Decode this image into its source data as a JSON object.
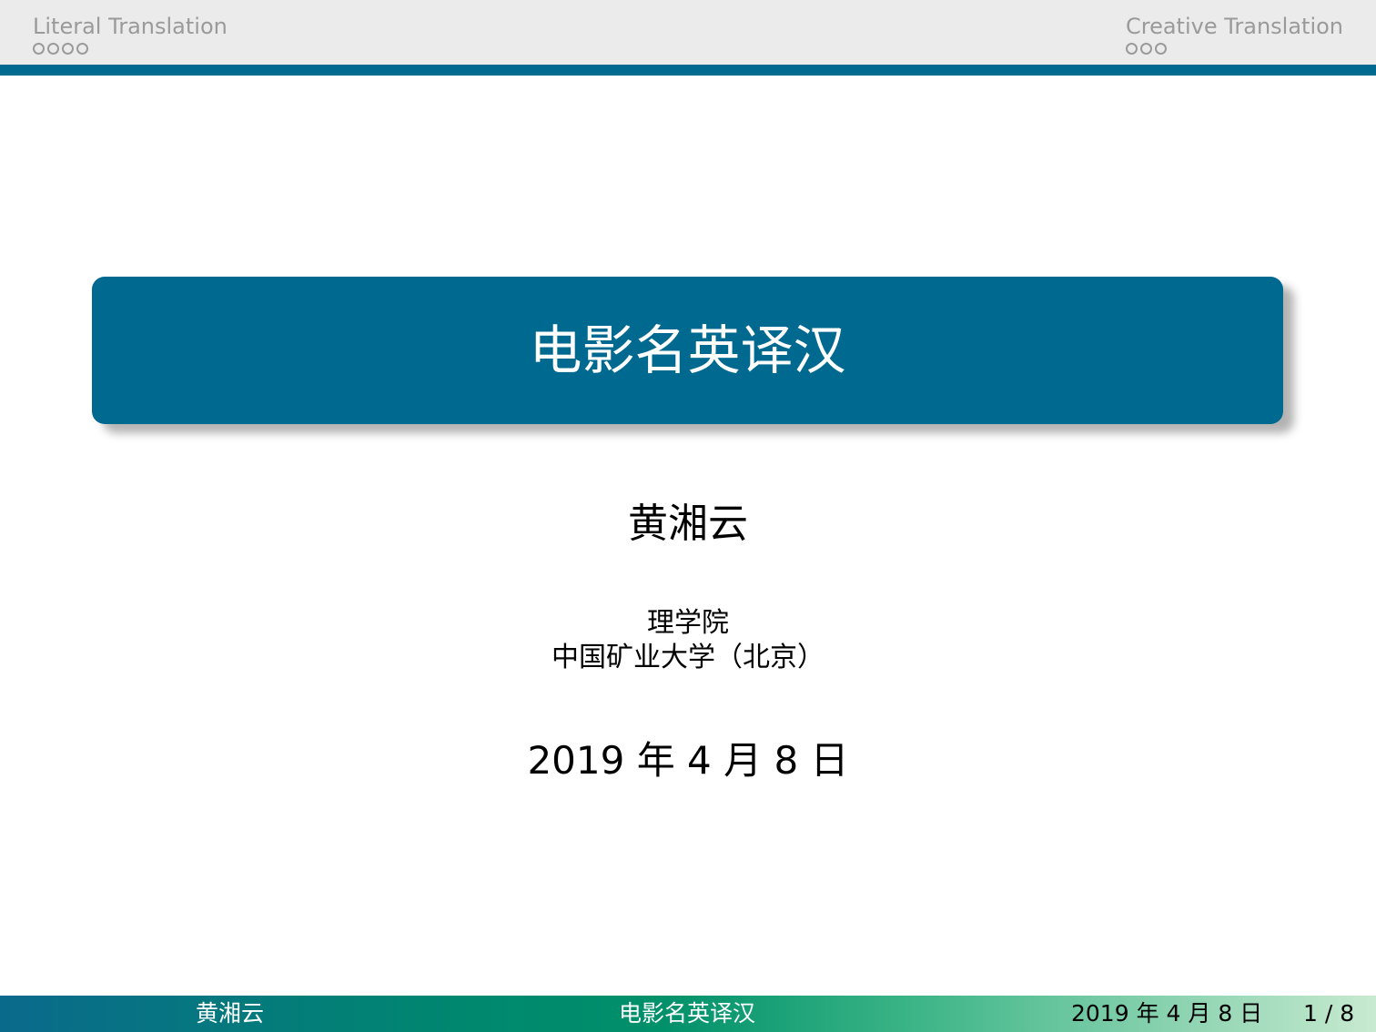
{
  "header": {
    "left_section": "Literal Translation",
    "right_section": "Creative Translation",
    "left_dots": 4,
    "right_dots": 3
  },
  "title": "电影名英译汉",
  "author": "黄湘云",
  "institute": {
    "line1": "理学院",
    "line2": "中国矿业大学（北京）"
  },
  "date": "2019 年 4 月 8 日",
  "footer": {
    "author": "黄湘云",
    "title": "电影名英译汉",
    "date": "2019 年 4 月 8 日",
    "page": "1 / 8"
  },
  "colors": {
    "primary": "#00698f",
    "header_bg": "#ebebeb",
    "nav_text": "#9a9a9a"
  }
}
